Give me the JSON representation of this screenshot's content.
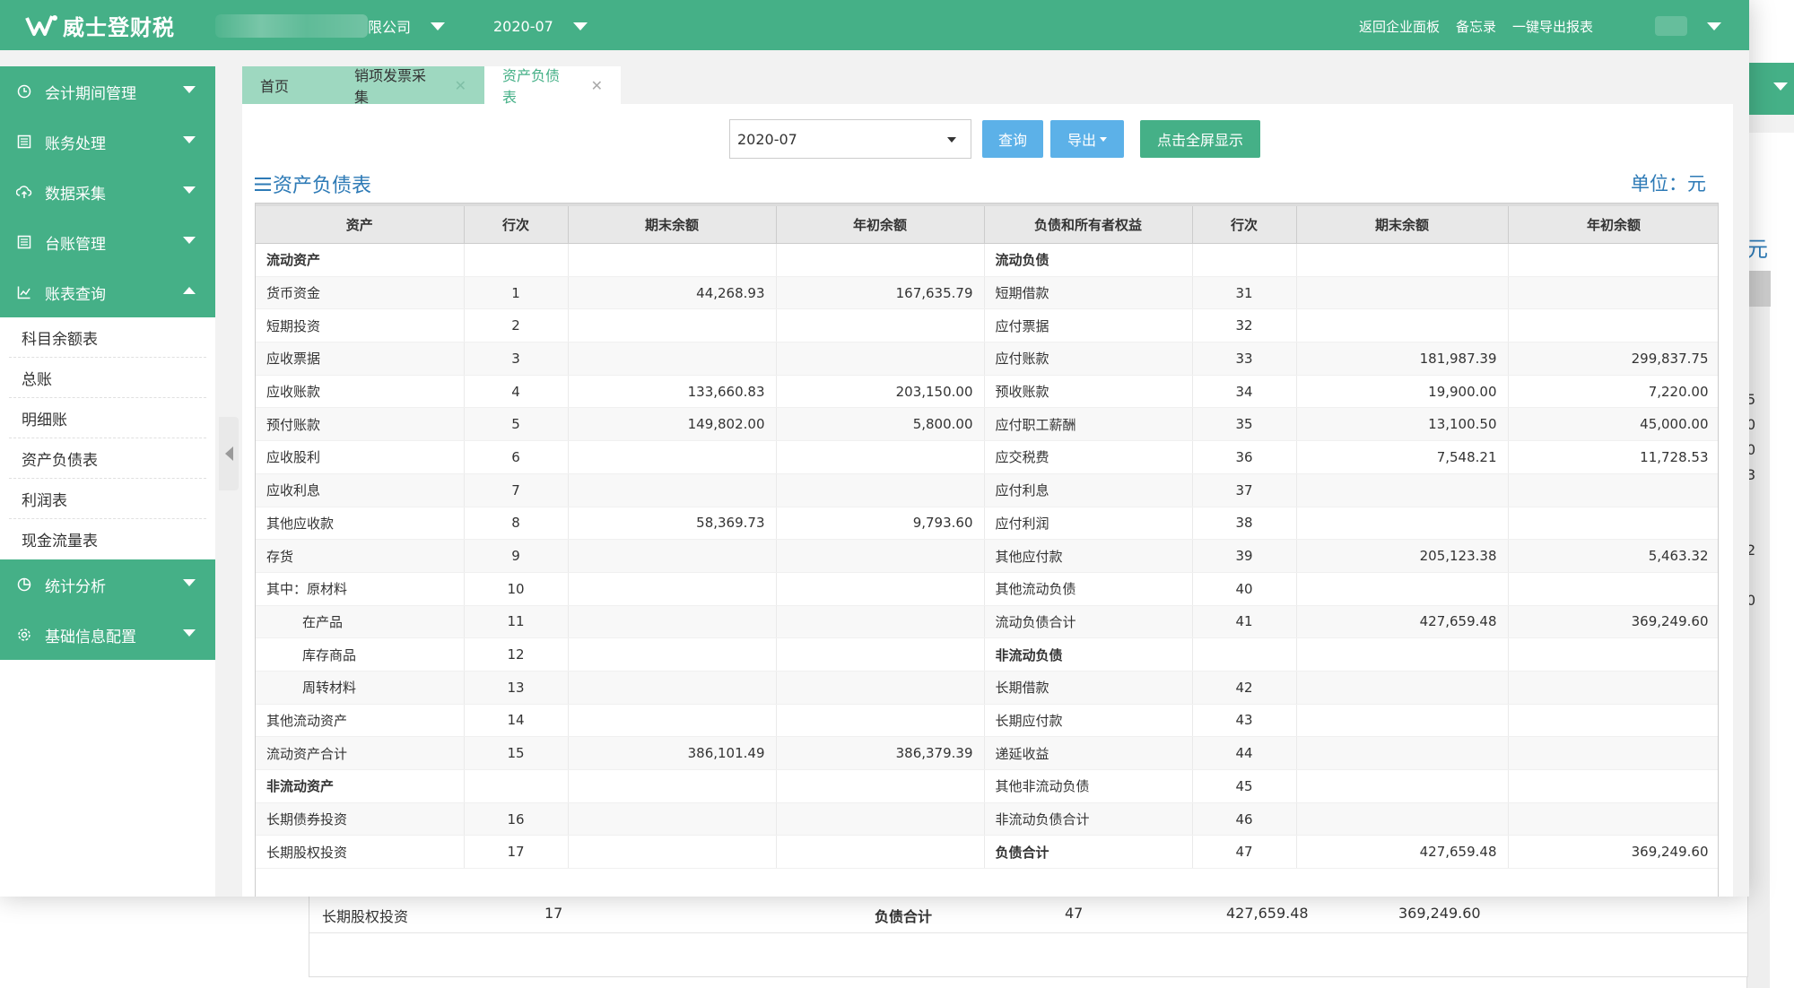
{
  "app": {
    "logo_text": "威士登财税",
    "company_suffix": "限公司",
    "period": "2020-07",
    "top_links": [
      "返回企业面板",
      "备忘录",
      "一键导出报表"
    ]
  },
  "sidebar": {
    "groups": [
      {
        "label": "会计期间管理",
        "icon": "clock-icon"
      },
      {
        "label": "账务处理",
        "icon": "ledger-icon"
      },
      {
        "label": "数据采集",
        "icon": "cloud-upload-icon"
      },
      {
        "label": "台账管理",
        "icon": "book-icon"
      },
      {
        "label": "账表查询",
        "icon": "line-chart-icon"
      }
    ],
    "sub_items": [
      "科目余额表",
      "总账",
      "明细账",
      "资产负债表",
      "利润表",
      "现金流量表"
    ],
    "bottom_groups": [
      {
        "label": "统计分析",
        "icon": "pie-chart-icon"
      },
      {
        "label": "基础信息配置",
        "icon": "gear-icon"
      }
    ]
  },
  "tabs": [
    {
      "label": "首页"
    },
    {
      "label": "销项发票采集"
    },
    {
      "label": "资产负债表"
    }
  ],
  "toolbar": {
    "period_value": "2020-07",
    "query_label": "查询",
    "export_label": "导出",
    "fullscreen_label": "点击全屏显示"
  },
  "report": {
    "title": "资产负债表",
    "unit": "单位：元"
  },
  "table": {
    "headers": [
      "资产",
      "行次",
      "期末余额",
      "年初余额",
      "负债和所有者权益",
      "行次",
      "期末余额",
      "年初余额"
    ],
    "rows": [
      [
        "流动资产",
        "",
        "",
        "",
        "流动负债",
        "",
        "",
        ""
      ],
      [
        "货币资金",
        "1",
        "44,268.93",
        "167,635.79",
        "短期借款",
        "31",
        "",
        ""
      ],
      [
        "短期投资",
        "2",
        "",
        "",
        "应付票据",
        "32",
        "",
        ""
      ],
      [
        "应收票据",
        "3",
        "",
        "",
        "应付账款",
        "33",
        "181,987.39",
        "299,837.75"
      ],
      [
        "应收账款",
        "4",
        "133,660.83",
        "203,150.00",
        "预收账款",
        "34",
        "19,900.00",
        "7,220.00"
      ],
      [
        "预付账款",
        "5",
        "149,802.00",
        "5,800.00",
        "应付职工薪酬",
        "35",
        "13,100.50",
        "45,000.00"
      ],
      [
        "应收股利",
        "6",
        "",
        "",
        "应交税费",
        "36",
        "7,548.21",
        "11,728.53"
      ],
      [
        "应收利息",
        "7",
        "",
        "",
        "应付利息",
        "37",
        "",
        ""
      ],
      [
        "其他应收款",
        "8",
        "58,369.73",
        "9,793.60",
        "应付利润",
        "38",
        "",
        ""
      ],
      [
        "存货",
        "9",
        "",
        "",
        "其他应付款",
        "39",
        "205,123.38",
        "5,463.32"
      ],
      [
        "其中：原材料",
        "10",
        "",
        "",
        "其他流动负债",
        "40",
        "",
        ""
      ],
      [
        "在产品",
        "11",
        "",
        "",
        "流动负债合计",
        "41",
        "427,659.48",
        "369,249.60"
      ],
      [
        "库存商品",
        "12",
        "",
        "",
        "非流动负债",
        "",
        "",
        ""
      ],
      [
        "周转材料",
        "13",
        "",
        "",
        "长期借款",
        "42",
        "",
        ""
      ],
      [
        "其他流动资产",
        "14",
        "",
        "",
        "长期应付款",
        "43",
        "",
        ""
      ],
      [
        "流动资产合计",
        "15",
        "386,101.49",
        "386,379.39",
        "递延收益",
        "44",
        "",
        ""
      ],
      [
        "非流动资产",
        "",
        "",
        "",
        "其他非流动负债",
        "45",
        "",
        ""
      ],
      [
        "长期债券投资",
        "16",
        "",
        "",
        "非流动负债合计",
        "46",
        "",
        ""
      ],
      [
        "长期股权投资",
        "17",
        "",
        "",
        "负债合计",
        "47",
        "427,659.48",
        "369,249.60"
      ]
    ],
    "bold_left_rows": [
      0,
      16
    ],
    "bold_right_rows": [
      0,
      12,
      18
    ],
    "indented_left_rows": [
      11,
      12,
      13
    ]
  },
  "background_window": {
    "unit_fragment": "元",
    "side_digits": [
      "5",
      "0",
      "0",
      "3",
      "2",
      "0"
    ],
    "row": [
      "长期股权投资",
      "17",
      "负债合计",
      "47",
      "427,659.48",
      "369,249.60"
    ]
  },
  "colors": {
    "brand_green": "#45b087",
    "light_green_tab": "#9ed8c0",
    "accent_blue": "#5cb1e8",
    "title_blue": "#2d7ab6"
  }
}
